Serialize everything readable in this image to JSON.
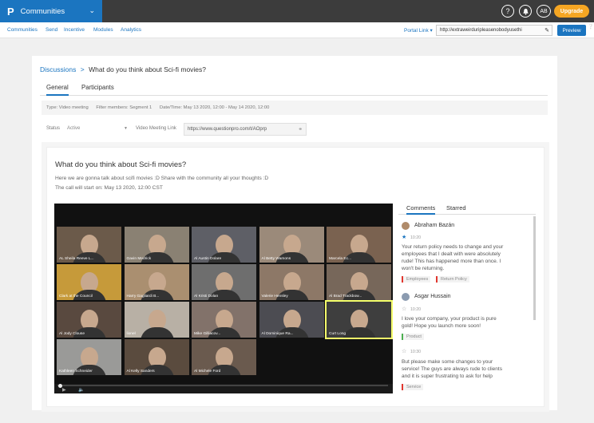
{
  "topbar": {
    "brand_logo": "P",
    "brand_name": "Communities",
    "help_icon": "?",
    "avatar_initials": "AB",
    "upgrade_label": "Upgrade"
  },
  "nav": {
    "items": [
      "Communities",
      "Send",
      "Incentive",
      "Modules",
      "Analytics"
    ],
    "portal_label": "Portal Link",
    "portal_value": "http://extraweirduripleasenobodyusethi",
    "preview_label": "Preview"
  },
  "breadcrumb": {
    "parent": "Discussions",
    "separator": ">",
    "current": "What do you think about Sci-fi movies?"
  },
  "tabs": [
    "General",
    "Participants"
  ],
  "meta": {
    "type": "Type: Video meeting",
    "filter": "Filter members: Segment 1",
    "datetime": "Date/Time: May 13 2020, 12:00 - May 14 2020, 12:00"
  },
  "status": {
    "label": "Status",
    "value": "Active",
    "video_link_label": "Video Meeting Link",
    "video_link_value": "https://www.questionpro.com/t/AOprp"
  },
  "discussion": {
    "title": "What do you think about Sci-fi movies?",
    "description": "Here we are gonna talk about scifi movies :D Share with the community all your thoughts :D",
    "start": "The call will start on: May 13 2020, 12:00 CST"
  },
  "video": {
    "tiles": [
      {
        "name": "AL Sheila Reeve L...",
        "color": "#6b5a4a"
      },
      {
        "name": "Gavin Medrick",
        "color": "#8a8173"
      },
      {
        "name": "Al Austin Dolare",
        "color": "#5e5f66"
      },
      {
        "name": "Al Betty Wamons",
        "color": "#9b8a7a"
      },
      {
        "name": "Marcela Ec...",
        "color": "#7a6250"
      },
      {
        "name": "Clark at the Council",
        "color": "#c69a3a"
      },
      {
        "name": "Harry Gagliardi B...",
        "color": "#aa8f70"
      },
      {
        "name": "Al Kristi Dolan",
        "color": "#6e6e6e"
      },
      {
        "name": "Valerie Hensley",
        "color": "#8d7867"
      },
      {
        "name": "Al Brad Trackbow...",
        "color": "#77675a"
      },
      {
        "name": "Al Jody Clouse",
        "color": "#59493f"
      },
      {
        "name": "lionel",
        "color": "#b8b0a5"
      },
      {
        "name": "Mike Gilliacov...",
        "color": "#82726a"
      },
      {
        "name": "Al Dominique Ra...",
        "color": "#4c4c52"
      },
      {
        "name": "Curt Long",
        "color": "#3e3e3e"
      },
      {
        "name": "Kathleen Schneider",
        "color": "#9a9a98"
      },
      {
        "name": "Al Kelly Sanders",
        "color": "#5a4b3e"
      },
      {
        "name": "Al Michele Ford",
        "color": "#6a5a4e"
      }
    ],
    "active_speaker_index": 14
  },
  "comments": {
    "tabs": [
      "Comments",
      "Starred"
    ],
    "items": [
      {
        "author": "Abraham Bazán",
        "date": "10:20",
        "text_lines": [
          "Your return policy needs to change and your",
          "employees that I dealt with were absolutely",
          "rude! This has happened more than once. I",
          "won't be returning."
        ],
        "tags": [
          "Employees",
          "Return Policy"
        ]
      },
      {
        "author": "Asgar Hussain",
        "date": "10:20",
        "text_lines": [
          "I love your company, your product is pure",
          "gold! Hope you launch more soon!"
        ],
        "tags": [
          "Product"
        ]
      },
      {
        "author": "",
        "date": "10:30",
        "text_lines": [
          "But please make some changes to your",
          "service! The guys are always rude to clients",
          "and it is super frustrating to ask for help"
        ],
        "tags": [
          "Service"
        ]
      }
    ]
  }
}
